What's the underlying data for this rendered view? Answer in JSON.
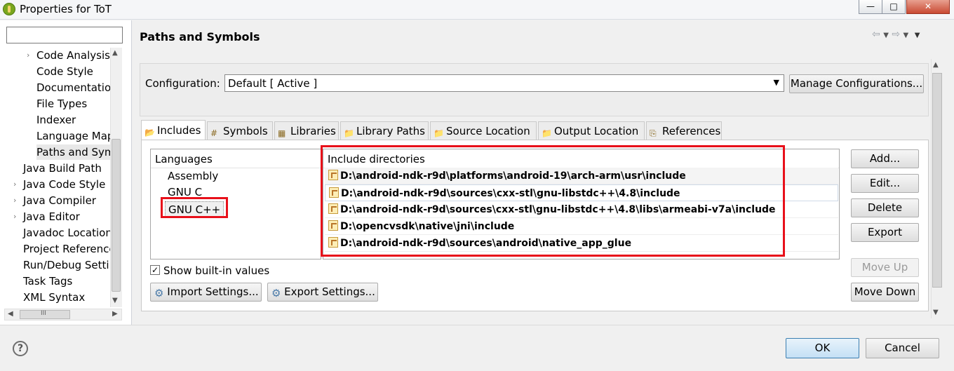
{
  "window": {
    "title": "Properties for ToT"
  },
  "window_buttons": {
    "minimize": "—",
    "maximize": "□",
    "close": "✕"
  },
  "nav": {
    "filter_value": "",
    "items": [
      {
        "label": "Code Analysis",
        "indent": 2,
        "arrow": "›"
      },
      {
        "label": "Code Style",
        "indent": 2
      },
      {
        "label": "Documentation",
        "indent": 2
      },
      {
        "label": "File Types",
        "indent": 2
      },
      {
        "label": "Indexer",
        "indent": 2
      },
      {
        "label": "Language Mappings",
        "indent": 2
      },
      {
        "label": "Paths and Symbols",
        "indent": 2,
        "selected": true
      },
      {
        "label": "Java Build Path",
        "indent": 1
      },
      {
        "label": "Java Code Style",
        "indent": 1,
        "arrow": "›"
      },
      {
        "label": "Java Compiler",
        "indent": 1,
        "arrow": "›"
      },
      {
        "label": "Java Editor",
        "indent": 1,
        "arrow": "›"
      },
      {
        "label": "Javadoc Location",
        "indent": 1
      },
      {
        "label": "Project References",
        "indent": 1
      },
      {
        "label": "Run/Debug Settings",
        "indent": 1
      },
      {
        "label": "Task Tags",
        "indent": 1
      },
      {
        "label": "XML Syntax",
        "indent": 1
      }
    ],
    "hscroll_grip": "III"
  },
  "page": {
    "title": "Paths and Symbols"
  },
  "config": {
    "label": "Configuration:",
    "value": "Default  [ Active ]",
    "manage_button": "Manage Configurations..."
  },
  "tabs": [
    {
      "label": "Includes",
      "icon": "includes-icon",
      "active": true
    },
    {
      "label": "Symbols",
      "icon": "hash-icon"
    },
    {
      "label": "Libraries",
      "icon": "library-icon"
    },
    {
      "label": "Library Paths",
      "icon": "folder-icon"
    },
    {
      "label": "Source Location",
      "icon": "folder-icon"
    },
    {
      "label": "Output Location",
      "icon": "folder-icon"
    },
    {
      "label": "References",
      "icon": "reference-icon"
    }
  ],
  "languages": {
    "header": "Languages",
    "items": [
      "Assembly",
      "GNU C",
      "GNU C++"
    ],
    "selected": "GNU C++"
  },
  "includes": {
    "header": "Include directories",
    "dirs": [
      "D:\\android-ndk-r9d\\platforms\\android-19\\arch-arm\\usr\\include",
      "D:\\android-ndk-r9d\\sources\\cxx-stl\\gnu-libstdc++\\4.8\\include",
      "D:\\android-ndk-r9d\\sources\\cxx-stl\\gnu-libstdc++\\4.8\\libs\\armeabi-v7a\\include",
      "D:\\opencvsdk\\native\\jni\\include",
      "D:\\android-ndk-r9d\\sources\\android\\native_app_glue"
    ]
  },
  "side_buttons": {
    "add": "Add...",
    "edit": "Edit...",
    "delete": "Delete",
    "export": "Export",
    "move_up": "Move Up",
    "move_down": "Move Down"
  },
  "show_builtin": {
    "label": "Show built-in values",
    "checked": true
  },
  "bottom_buttons": {
    "import": "Import Settings...",
    "export": "Export Settings..."
  },
  "dialog": {
    "ok": "OK",
    "cancel": "Cancel",
    "help": "?"
  }
}
